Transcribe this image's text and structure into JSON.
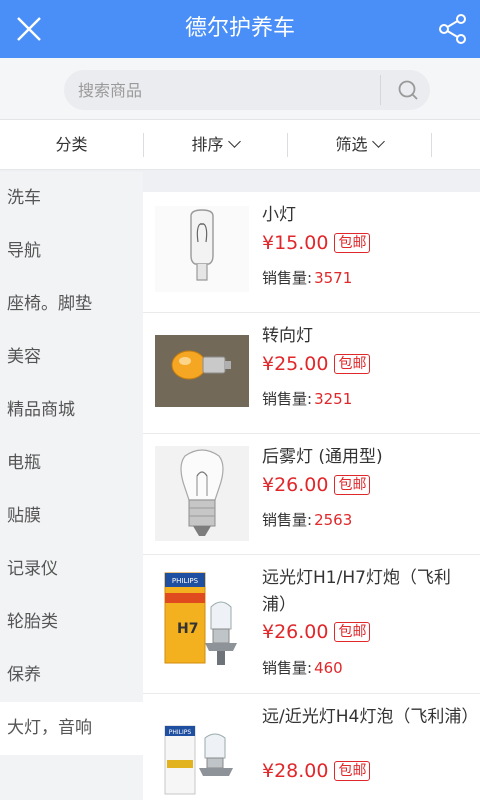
{
  "header": {
    "title": "德尔护养车",
    "close_icon": "close-icon",
    "share_icon": "share-icon"
  },
  "search": {
    "placeholder": "搜索商品",
    "icon": "search-icon"
  },
  "filter": {
    "tabs": [
      "分类",
      "排序",
      "筛选"
    ]
  },
  "sidebar": {
    "items": [
      "洗车",
      "导航",
      "座椅。脚垫",
      "美容",
      "精品商城",
      "电瓶",
      "贴膜",
      "记录仪",
      "轮胎类",
      "保养",
      "大灯，音响"
    ],
    "active_index": 10
  },
  "products": [
    {
      "name": "小灯",
      "price": "¥15.00",
      "badge": "包邮",
      "sales_label": "销售量:",
      "sales": "3571"
    },
    {
      "name": "转向灯",
      "price": "¥25.00",
      "badge": "包邮",
      "sales_label": "销售量:",
      "sales": "3251"
    },
    {
      "name": "后雾灯 (通用型)",
      "price": "¥26.00",
      "badge": "包邮",
      "sales_label": "销售量:",
      "sales": "2563"
    },
    {
      "name": "远光灯H1/H7灯炮（飞利浦）",
      "price": "¥26.00",
      "badge": "包邮",
      "sales_label": "销售量:",
      "sales": "460",
      "thumb_text": {
        "brand": "PHILIPS",
        "bulb": "H7"
      }
    },
    {
      "name": "远/近光灯H4灯泡（飞利浦）",
      "price": "¥28.00",
      "badge": "包邮",
      "thumb_text": {
        "brand": "PHILIPS"
      }
    }
  ],
  "colors": {
    "header_bg": "#4a8ef7",
    "price_red": "#e0282b"
  }
}
